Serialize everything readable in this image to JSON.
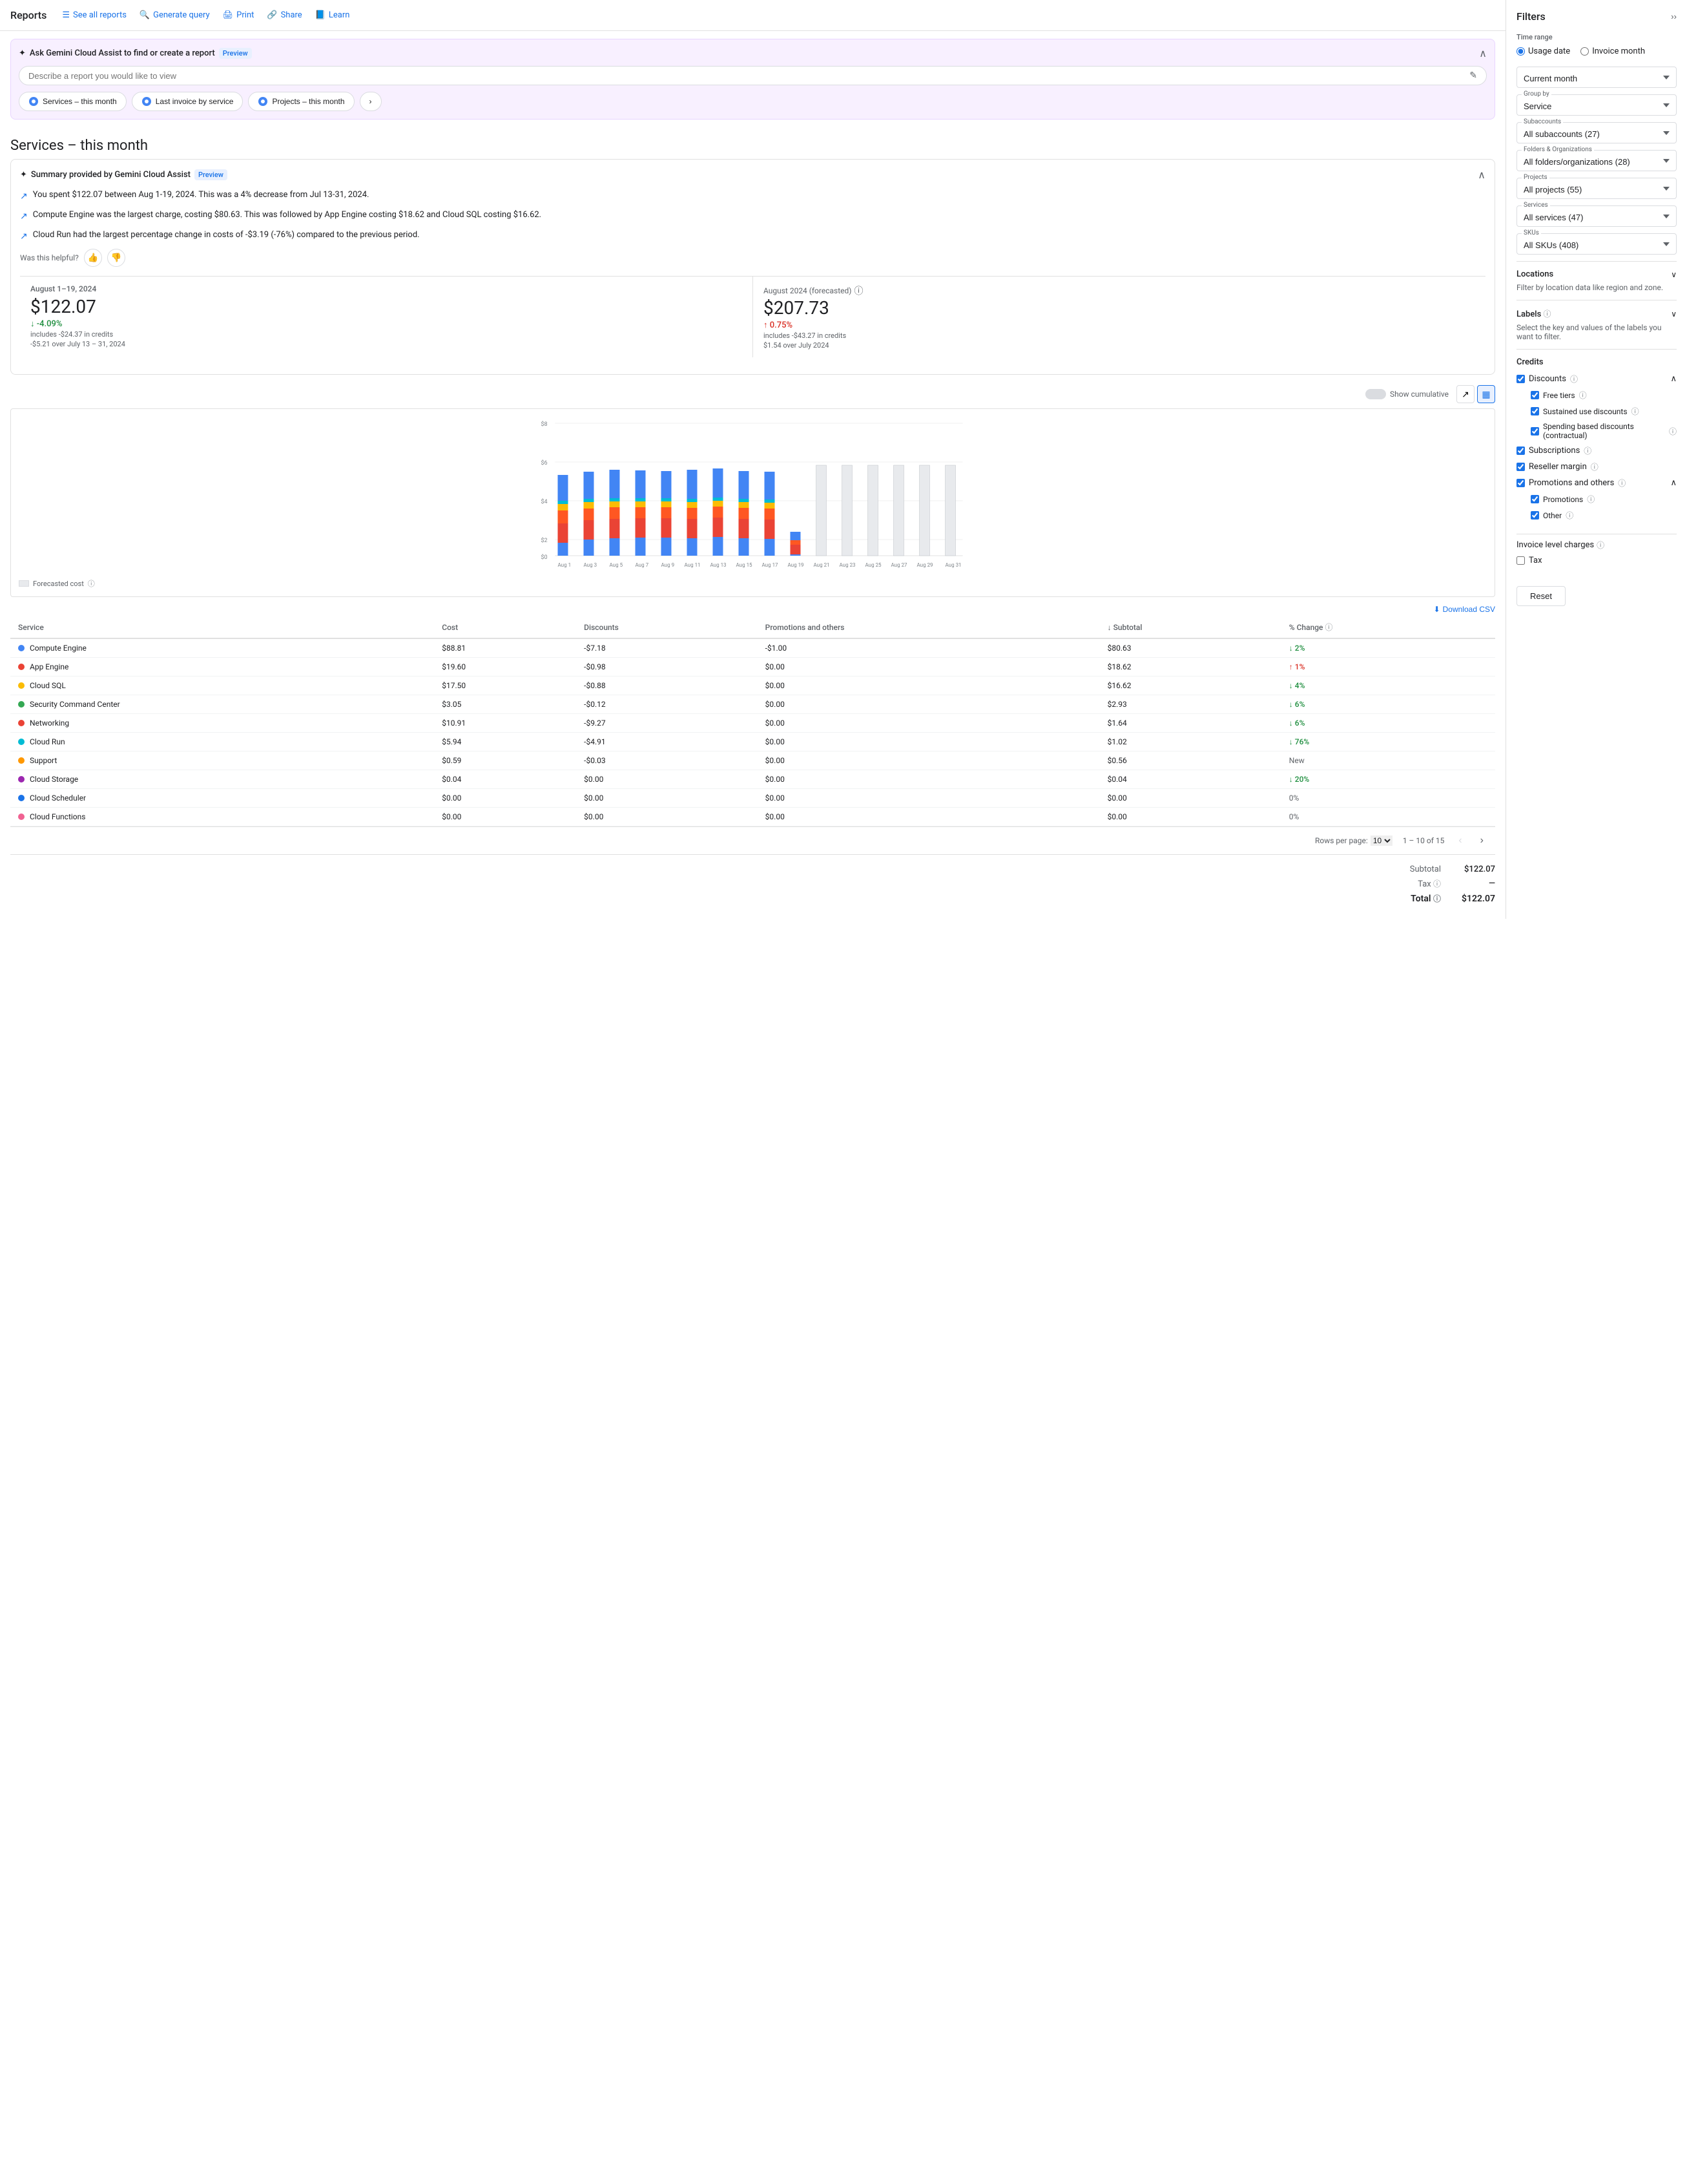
{
  "nav": {
    "title": "Reports",
    "links": [
      {
        "label": "See all reports",
        "icon": "☰"
      },
      {
        "label": "Generate query",
        "icon": "🔍"
      },
      {
        "label": "Print",
        "icon": "🖨"
      },
      {
        "label": "Share",
        "icon": "🔗"
      },
      {
        "label": "Learn",
        "icon": "📘"
      }
    ]
  },
  "gemini": {
    "title": "Ask Gemini Cloud Assist to find or create a report",
    "badge": "Preview",
    "placeholder": "Describe a report you would like to view",
    "quick_reports": [
      {
        "label": "Services – this month"
      },
      {
        "label": "Last invoice by service"
      },
      {
        "label": "Projects – this month"
      }
    ]
  },
  "page_title": "Services – this month",
  "summary": {
    "title": "Summary provided by Gemini Cloud Assist",
    "badge": "Preview",
    "bullets": [
      "You spent $122.07 between Aug 1-19, 2024. This was a 4% decrease from Jul 13-31, 2024.",
      "Compute Engine was the largest charge, costing $80.63. This was followed by App Engine costing $18.62 and Cloud SQL costing $16.62.",
      "Cloud Run had the largest percentage change in costs of -$3.19 (-76%) compared to the previous period."
    ],
    "feedback_label": "Was this helpful?"
  },
  "stats": {
    "current": {
      "period": "August 1–19, 2024",
      "amount": "$122.07",
      "change": "↓ -4.09%",
      "change_type": "down",
      "sub": "includes -$24.37 in credits",
      "change_sub": "-$5.21 over July 13 – 31, 2024"
    },
    "forecasted": {
      "period": "August 2024 (forecasted)",
      "amount": "$207.73",
      "change": "↑ 0.75%",
      "change_type": "up",
      "sub": "includes -$43.27 in credits",
      "change_sub": "$1.54 over July 2024"
    }
  },
  "chart": {
    "y_labels": [
      "$8",
      "$6",
      "$4",
      "$2",
      "$0"
    ],
    "x_labels": [
      "Aug 1",
      "Aug 3",
      "Aug 5",
      "Aug 7",
      "Aug 9",
      "Aug 11",
      "Aug 13",
      "Aug 15",
      "Aug 17",
      "Aug 19",
      "Aug 21",
      "Aug 23",
      "Aug 25",
      "Aug 27",
      "Aug 29",
      "Aug 31"
    ],
    "show_cumulative": "Show cumulative",
    "forecasted_cost": "Forecasted cost"
  },
  "download": {
    "label": "Download CSV"
  },
  "table": {
    "headers": [
      "Service",
      "Cost",
      "Discounts",
      "Promotions and others",
      "Subtotal",
      "% Change"
    ],
    "rows": [
      {
        "color": "#4285f4",
        "service": "Compute Engine",
        "cost": "$88.81",
        "discounts": "-$7.18",
        "promotions": "-$1.00",
        "subtotal": "$80.63",
        "change": "↓ 2%",
        "change_type": "down"
      },
      {
        "color": "#ea4335",
        "service": "App Engine",
        "cost": "$19.60",
        "discounts": "-$0.98",
        "promotions": "$0.00",
        "subtotal": "$18.62",
        "change": "↑ 1%",
        "change_type": "up"
      },
      {
        "color": "#fbbc04",
        "service": "Cloud SQL",
        "cost": "$17.50",
        "discounts": "-$0.88",
        "promotions": "$0.00",
        "subtotal": "$16.62",
        "change": "↓ 4%",
        "change_type": "down"
      },
      {
        "color": "#34a853",
        "service": "Security Command Center",
        "cost": "$3.05",
        "discounts": "-$0.12",
        "promotions": "$0.00",
        "subtotal": "$2.93",
        "change": "↓ 6%",
        "change_type": "down"
      },
      {
        "color": "#ea4335",
        "service": "Networking",
        "cost": "$10.91",
        "discounts": "-$9.27",
        "promotions": "$0.00",
        "subtotal": "$1.64",
        "change": "↓ 6%",
        "change_type": "down"
      },
      {
        "color": "#00bcd4",
        "service": "Cloud Run",
        "cost": "$5.94",
        "discounts": "-$4.91",
        "promotions": "$0.00",
        "subtotal": "$1.02",
        "change": "↓ 76%",
        "change_type": "down"
      },
      {
        "color": "#ff9800",
        "service": "Support",
        "cost": "$0.59",
        "discounts": "-$0.03",
        "promotions": "$0.00",
        "subtotal": "$0.56",
        "change": "New",
        "change_type": "neutral"
      },
      {
        "color": "#9c27b0",
        "service": "Cloud Storage",
        "cost": "$0.04",
        "discounts": "$0.00",
        "promotions": "$0.00",
        "subtotal": "$0.04",
        "change": "↓ 20%",
        "change_type": "down"
      },
      {
        "color": "#1a73e8",
        "service": "Cloud Scheduler",
        "cost": "$0.00",
        "discounts": "$0.00",
        "promotions": "$0.00",
        "subtotal": "$0.00",
        "change": "0%",
        "change_type": "neutral"
      },
      {
        "color": "#f06292",
        "service": "Cloud Functions",
        "cost": "$0.00",
        "discounts": "$0.00",
        "promotions": "$0.00",
        "subtotal": "$0.00",
        "change": "0%",
        "change_type": "neutral"
      }
    ],
    "pagination": {
      "rows_per_page": "Rows per page:",
      "rows_value": "10",
      "range": "1 – 10 of 15"
    }
  },
  "totals": {
    "subtotal_label": "Subtotal",
    "subtotal_value": "$122.07",
    "tax_label": "Tax",
    "tax_help": "?",
    "tax_value": "—",
    "total_label": "Total",
    "total_help": "?",
    "total_value": "$122.07"
  },
  "filters": {
    "title": "Filters",
    "time_range": {
      "label": "Time range",
      "options": [
        "Usage date",
        "Invoice month"
      ],
      "selected": "Usage date"
    },
    "current_month": {
      "label": "Current month",
      "value": "Current month"
    },
    "group_by": {
      "label": "Group by",
      "value": "Service"
    },
    "subaccounts": {
      "label": "Subaccounts",
      "value": "All subaccounts (27)"
    },
    "folders": {
      "label": "Folders & Organizations",
      "value": "All folders/organizations (28)"
    },
    "projects": {
      "label": "Projects",
      "value": "All projects (55)"
    },
    "services": {
      "label": "Services",
      "value": "All services (47)"
    },
    "skus": {
      "label": "SKUs",
      "value": "All SKUs (408)"
    },
    "locations": {
      "label": "Locations",
      "desc": "Filter by location data like region and zone."
    },
    "labels": {
      "label": "Labels",
      "desc": "Select the key and values of the labels you want to filter."
    },
    "credits": {
      "label": "Credits",
      "discounts": {
        "label": "Discounts",
        "checked": true,
        "sub": [
          {
            "label": "Free tiers",
            "checked": true
          },
          {
            "label": "Sustained use discounts",
            "checked": true
          },
          {
            "label": "Spending based discounts (contractual)",
            "checked": true
          }
        ]
      },
      "subscriptions": {
        "label": "Subscriptions",
        "checked": true
      },
      "reseller_margin": {
        "label": "Reseller margin",
        "checked": true
      },
      "promotions": {
        "label": "Promotions and others",
        "checked": true,
        "sub": [
          {
            "label": "Promotions",
            "checked": true
          },
          {
            "label": "Other",
            "checked": true
          }
        ]
      }
    },
    "invoice_level_charges": {
      "label": "Invoice level charges",
      "tax": {
        "label": "Tax",
        "checked": false
      }
    },
    "reset_label": "Reset"
  }
}
